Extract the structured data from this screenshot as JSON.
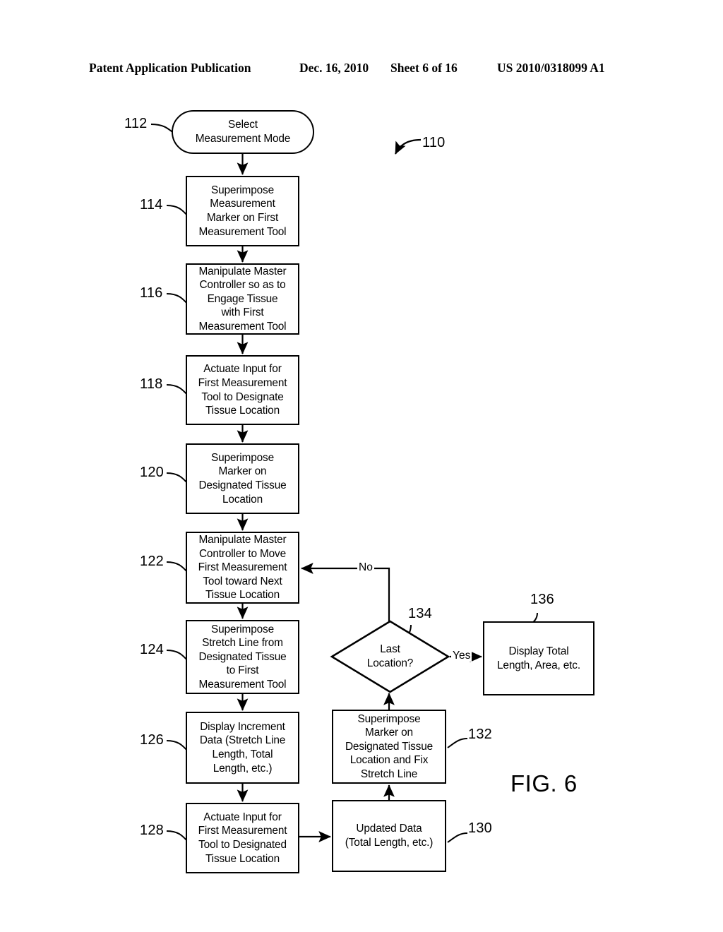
{
  "header": {
    "publication": "Patent Application Publication",
    "date": "Dec. 16, 2010",
    "sheet": "Sheet 6 of 16",
    "patent_number": "US 2010/0318099 A1"
  },
  "figure": {
    "caption": "FIG. 6",
    "diagram_ref": "110"
  },
  "nodes": [
    {
      "ref": "112",
      "shape": "terminator",
      "text": "Select\nMeasurement Mode"
    },
    {
      "ref": "114",
      "shape": "process",
      "text": "Superimpose\nMeasurement\nMarker on First\nMeasurement Tool"
    },
    {
      "ref": "116",
      "shape": "process",
      "text": "Manipulate Master\nController so as to\nEngage Tissue\nwith First\nMeasurement Tool"
    },
    {
      "ref": "118",
      "shape": "process",
      "text": "Actuate Input for\nFirst Measurement\nTool to Designate\nTissue Location"
    },
    {
      "ref": "120",
      "shape": "process",
      "text": "Superimpose\nMarker on\nDesignated Tissue\nLocation"
    },
    {
      "ref": "122",
      "shape": "process",
      "text": "Manipulate Master\nController to Move\nFirst Measurement\nTool toward Next\nTissue Location"
    },
    {
      "ref": "124",
      "shape": "process",
      "text": "Superimpose\nStretch Line from\nDesignated Tissue\nto First\nMeasurement Tool"
    },
    {
      "ref": "126",
      "shape": "process",
      "text": "Display Increment\nData (Stretch Line\nLength, Total\nLength, etc.)"
    },
    {
      "ref": "128",
      "shape": "process",
      "text": "Actuate Input for\nFirst Measurement\nTool to Designated\nTissue Location"
    },
    {
      "ref": "130",
      "shape": "process",
      "text": "Updated Data\n(Total Length, etc.)"
    },
    {
      "ref": "132",
      "shape": "process",
      "text": "Superimpose\nMarker on\nDesignated Tissue\nLocation and Fix\nStretch Line"
    },
    {
      "ref": "134",
      "shape": "decision",
      "text": "Last\nLocation?"
    },
    {
      "ref": "136",
      "shape": "process",
      "text": "Display Total\nLength, Area, etc."
    }
  ],
  "branch_labels": {
    "no": "No",
    "yes": "Yes"
  },
  "colors": {
    "ink": "#000000",
    "paper": "#ffffff"
  }
}
